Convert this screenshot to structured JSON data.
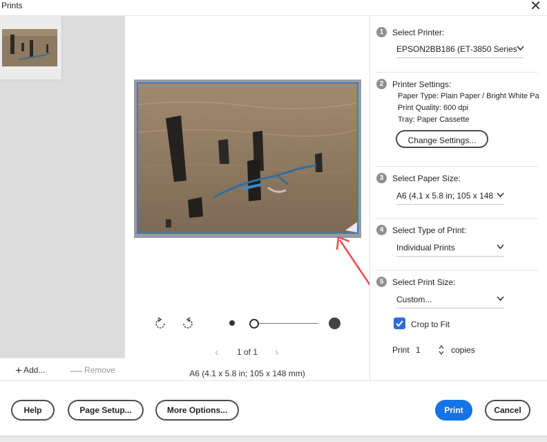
{
  "window": {
    "title": "Prints"
  },
  "thumbnails": {
    "add_label": "Add...",
    "remove_label": "Remove"
  },
  "preview": {
    "page_label": "1 of 1",
    "paper_caption": "A6 (4.1 x 5.8 in; 105 x 148 mm)"
  },
  "settings": {
    "printer": {
      "step": "1",
      "label": "Select Printer:",
      "value": "EPSON2BB186 (ET-3850 Series)"
    },
    "printer_settings": {
      "step": "2",
      "label": "Printer Settings:",
      "paper_type": "Paper Type: Plain Paper / Bright White Pa",
      "print_quality": "Print Quality: 600 dpi",
      "tray": "Tray: Paper Cassette",
      "change_button": "Change Settings..."
    },
    "paper_size": {
      "step": "3",
      "label": "Select Paper Size:",
      "value": "A6 (4.1 x 5.8 in; 105 x 148"
    },
    "print_type": {
      "step": "4",
      "label": "Select Type of Print:",
      "value": "Individual Prints"
    },
    "print_size": {
      "step": "5",
      "label": "Select Print Size:",
      "value": "Custom..."
    },
    "crop_to_fit": {
      "label": "Crop to Fit",
      "checked": true
    },
    "copies": {
      "label_prefix": "Print",
      "value": "1",
      "label_suffix": "copies"
    }
  },
  "footer": {
    "help": "Help",
    "page_setup": "Page Setup...",
    "more_options": "More Options...",
    "print": "Print",
    "cancel": "Cancel"
  },
  "colors": {
    "accent": "#1473e6",
    "selection_outline": "#3a78d0",
    "annotation_arrow": "#e84a4a"
  },
  "icons": [
    "close-icon",
    "plus-icon",
    "minus-icon",
    "rotate-left-icon",
    "rotate-right-icon",
    "chevron-left-icon",
    "chevron-right-icon",
    "chevron-down-icon",
    "checkmark-icon",
    "stepper-icon"
  ]
}
